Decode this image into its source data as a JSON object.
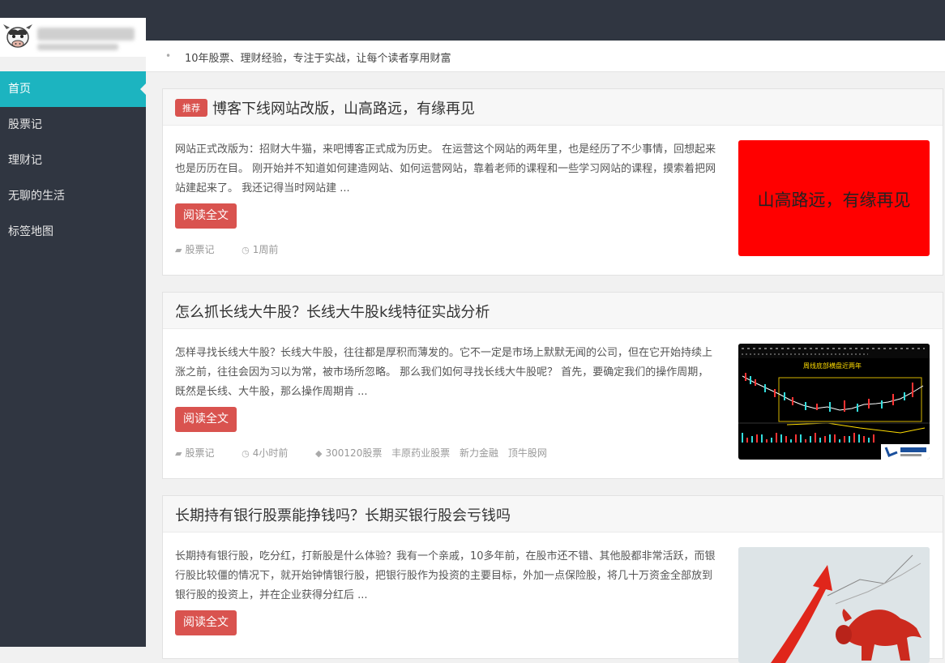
{
  "header": {
    "tagline": "10年股票、理财经验，专注于实战，让每个读者享用财富"
  },
  "sidebar": {
    "items": [
      {
        "label": "首页"
      },
      {
        "label": "股票记"
      },
      {
        "label": "理财记"
      },
      {
        "label": "无聊的生活"
      },
      {
        "label": "标签地图"
      }
    ]
  },
  "posts": [
    {
      "badge": "推荐",
      "title": "博客下线网站改版，山高路远，有缘再见",
      "excerpt": "网站正式改版为：招财大牛猫，来吧博客正式成为历史。 在运营这个网站的两年里，也是经历了不少事情，回想起来也是历历在目。 刚开始并不知道如何建造网站、如何运营网站，靠着老师的课程和一些学习网站的课程，摸索着把网站建起来了。 我还记得当时网站建 ...",
      "read_more": "阅读全文",
      "category": "股票记",
      "time": "1周前",
      "thumb_text": "山高路远，有缘再见"
    },
    {
      "title": "怎么抓长线大牛股？长线大牛股k线特征实战分析",
      "excerpt": "怎样寻找长线大牛股？长线大牛股，往往都是厚积而薄发的。它不一定是市场上默默无闻的公司，但在它开始持续上涨之前，往往会因为习以为常，被市场所忽略。 那么我们如何寻找长线大牛股呢？ 首先，要确定我们的操作周期，既然是长线、大牛股，那么操作周期肯 ...",
      "read_more": "阅读全文",
      "category": "股票记",
      "time": "4小时前",
      "tags": [
        "300120股票",
        "丰原药业股票",
        "新力金融",
        "顶牛股网"
      ],
      "thumb_caption": "周线底部横盘近两年"
    },
    {
      "title": "长期持有银行股票能挣钱吗？长期买银行股会亏钱吗",
      "excerpt": "长期持有银行股，吃分红，打新股是什么体验？我有一个亲戚，10多年前，在股市还不错、其他股都非常活跃，而银行股比较僵的情况下，就开始钟情银行股，把银行股作为投资的主要目标，外加一点保险股，将几十万资金全部放到银行股的投资上，并在企业获得分红后 ...",
      "read_more": "阅读全文"
    }
  ],
  "colors": {
    "topbar": "#303641",
    "accent": "#1cb4c0",
    "button": "#d9534f",
    "thumb_red": "#ff0000"
  }
}
